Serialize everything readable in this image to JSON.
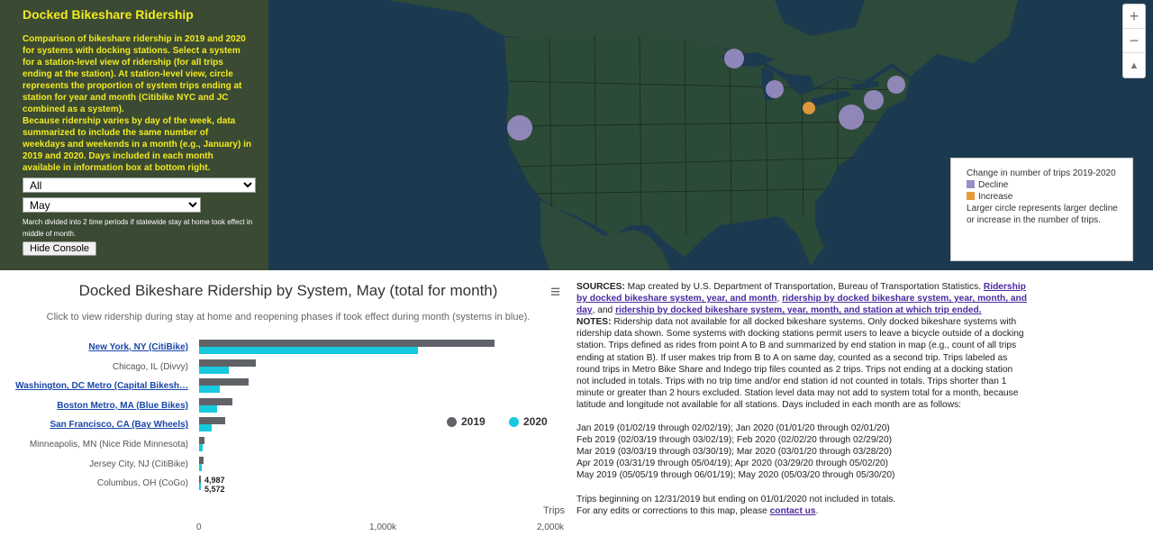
{
  "console": {
    "title": "Docked Bikeshare Ridership",
    "description": "Comparison of bikeshare ridership in 2019 and 2020 for systems with docking stations. Select a system for a station-level view of ridership (for all trips ending at the station). At station-level view, circle represents the proportion of system trips ending at station for year and month (Citibike NYC and JC combined as a system).",
    "description2": "Because ridership varies by day of the week, data summarized to include the same number of weekdays and weekends in a month (e.g., January) in 2019 and 2020. Days included in each month available in information box at bottom right.",
    "system_select": "All",
    "month_select": "May",
    "note": "March divided into 2 time periods if statewide stay at home took effect in middle of month.",
    "hide_button": "Hide Console"
  },
  "map": {
    "zoom_in": "+",
    "zoom_out": "−",
    "north": "▲",
    "legend": {
      "title": "Change in number of trips 2019-2020",
      "decline": "Decline",
      "increase": "Increase",
      "note": "Larger circle represents larger decline or increase in the number of trips.",
      "decline_color": "#9b8ec7",
      "increase_color": "#e89a3a"
    }
  },
  "chart": {
    "title": "Docked Bikeshare Ridership by System, May (total for month)",
    "subtitle": "Click to view ridership during stay at home and reopening phases if took effect during month (systems in blue).",
    "menu_icon": "≡",
    "axis_title": "Trips",
    "ticks": [
      "0",
      "1,000k",
      "2,000k"
    ],
    "legend": [
      "2019",
      "2020"
    ],
    "data_labels": [
      "4,987",
      "5,572"
    ]
  },
  "chart_data": {
    "type": "bar",
    "orientation": "horizontal",
    "title": "Docked Bikeshare Ridership by System, May (total for month)",
    "xlabel": "Trips",
    "xlim": [
      0,
      2000000
    ],
    "categories": [
      "New York, NY (CitiBike)",
      "Chicago, IL (Divvy)",
      "Washington, DC Metro (Capital Bikesh…",
      "Boston Metro, MA (Blue Bikes)",
      "San Francisco, CA (Bay Wheels)",
      "Minneapolis, MN (Nice Ride Minnesota)",
      "Jersey City, NJ (CitiBike)",
      "Columbus, OH (CoGo)"
    ],
    "linked": [
      true,
      false,
      true,
      true,
      true,
      false,
      false,
      false
    ],
    "series": [
      {
        "name": "2019",
        "color": "#5f6368",
        "values": [
          1680000,
          320000,
          280000,
          190000,
          150000,
          30000,
          27000,
          4987
        ]
      },
      {
        "name": "2020",
        "color": "#17c9dd",
        "values": [
          1245000,
          170000,
          120000,
          100000,
          70000,
          22000,
          17000,
          5572
        ]
      }
    ]
  },
  "sources": {
    "label": "SOURCES:",
    "text1": "Map created by U.S. Department of Transportation, Bureau of Transportation Statistics.",
    "link1": "Ridership by docked bikeshare system, year, and month",
    "sep1": ",",
    "link2": "ridership by docked bikeshare system, year, month, and day",
    "sep2": ", and",
    "link3": "ridership by docked bikeshare system, year, month, and station at which trip ended.",
    "notes_label": "NOTES:",
    "notes": "Ridership data not available for all docked bikeshare systems. Only docked bikeshare systems with ridership data shown. Some systems with docking stations permit users to leave a bicycle outside of a docking station. Trips defined as rides from point A to B and summarized by end station in map (e.g., count of all trips ending at station B). If user makes trip from B to A on same day, counted as a second trip. Trips labeled as round trips in Metro Bike Share and Indego trip files counted as 2 trips. Trips not ending at a docking station not included in totals. Trips with no trip time and/or end station id not counted in totals. Trips shorter than 1 minute or greater than 2 hours excluded. Station level data may not add to system total for a month, because latitude and longitude not available for all stations. Days included in each month are as follows:",
    "months": [
      "Jan 2019 (01/02/19 through 02/02/19); Jan 2020 (01/01/20 through 02/01/20)",
      "Feb 2019 (02/03/19 through 03/02/19); Feb 2020 (02/02/20 through 02/29/20)",
      "Mar 2019 (03/03/19 through 03/30/19); Mar 2020 (03/01/20 through 03/28/20)",
      "Apr 2019 (03/31/19 through 05/04/19); Apr 2020 (03/29/20 through 05/02/20)",
      "May 2019 (05/05/19 through 06/01/19); May 2020 (05/03/20 through 05/30/20)"
    ],
    "footer1": "Trips beginning on 12/31/2019 but ending on 01/01/2020 not included in totals.",
    "footer2": "For any edits or corrections to this map, please",
    "contact": "contact us",
    "period": "."
  }
}
